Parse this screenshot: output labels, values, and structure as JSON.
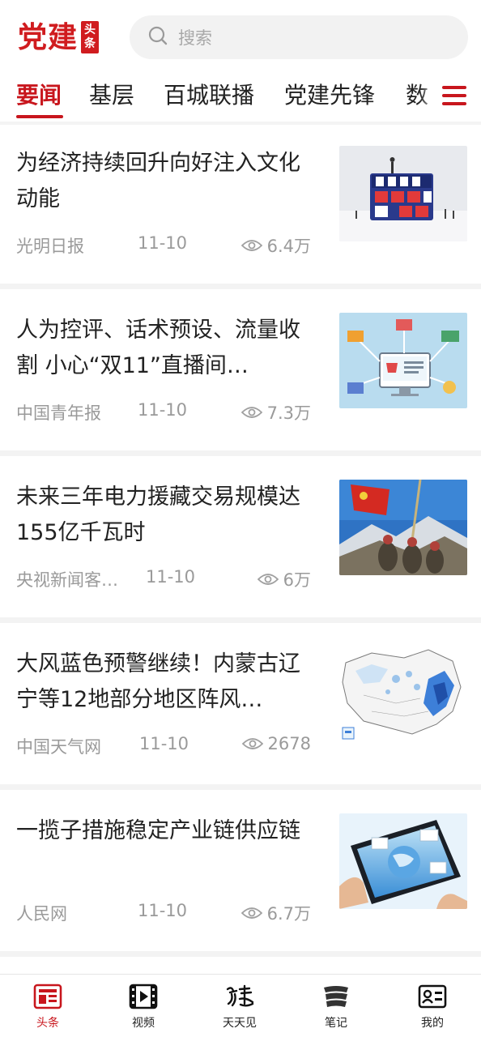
{
  "header": {
    "logo_text": "党建",
    "logo_badge_top": "头",
    "logo_badge_bottom": "条",
    "search_placeholder": "搜索"
  },
  "tabs": [
    {
      "label": "要闻",
      "active": true
    },
    {
      "label": "基层",
      "active": false
    },
    {
      "label": "百城联播",
      "active": false
    },
    {
      "label": "党建先锋",
      "active": false
    },
    {
      "label": "数",
      "active": false
    }
  ],
  "news": [
    {
      "title": "为经济持续回升向好注入文化动能",
      "source": "光明日报",
      "date": "11-10",
      "views": "6.4万",
      "thumb": "cube-economy-image"
    },
    {
      "title": "人为控评、话术预设、流量收割 小心“双11”直播间…",
      "source": "中国青年报",
      "date": "11-10",
      "views": "7.3万",
      "thumb": "ecommerce-illustration"
    },
    {
      "title": "未来三年电力援藏交易规模达155亿千瓦时",
      "source": "央视新闻客…",
      "date": "11-10",
      "views": "6万",
      "thumb": "flag-mountain-photo"
    },
    {
      "title": "大风蓝色预警继续！内蒙古辽宁等12地部分地区阵风…",
      "source": "中国天气网",
      "date": "11-10",
      "views": "2678",
      "thumb": "weather-map"
    },
    {
      "title": "一揽子措施稳定产业链供应链",
      "source": "人民网",
      "date": "11-10",
      "views": "6.7万",
      "thumb": "tablet-globe-image"
    }
  ],
  "bottom_nav": [
    {
      "label": "头条",
      "icon": "newspaper-icon",
      "active": true
    },
    {
      "label": "视频",
      "icon": "video-icon",
      "active": false
    },
    {
      "label": "天天见",
      "icon": "calligraphy-dangjian-icon",
      "active": false
    },
    {
      "label": "笔记",
      "icon": "notes-icon",
      "active": false
    },
    {
      "label": "我的",
      "icon": "profile-card-icon",
      "active": false
    }
  ],
  "colors": {
    "brand_red": "#c8161d",
    "meta_gray": "#9a9a9a",
    "divider": "#f3f3f3"
  }
}
